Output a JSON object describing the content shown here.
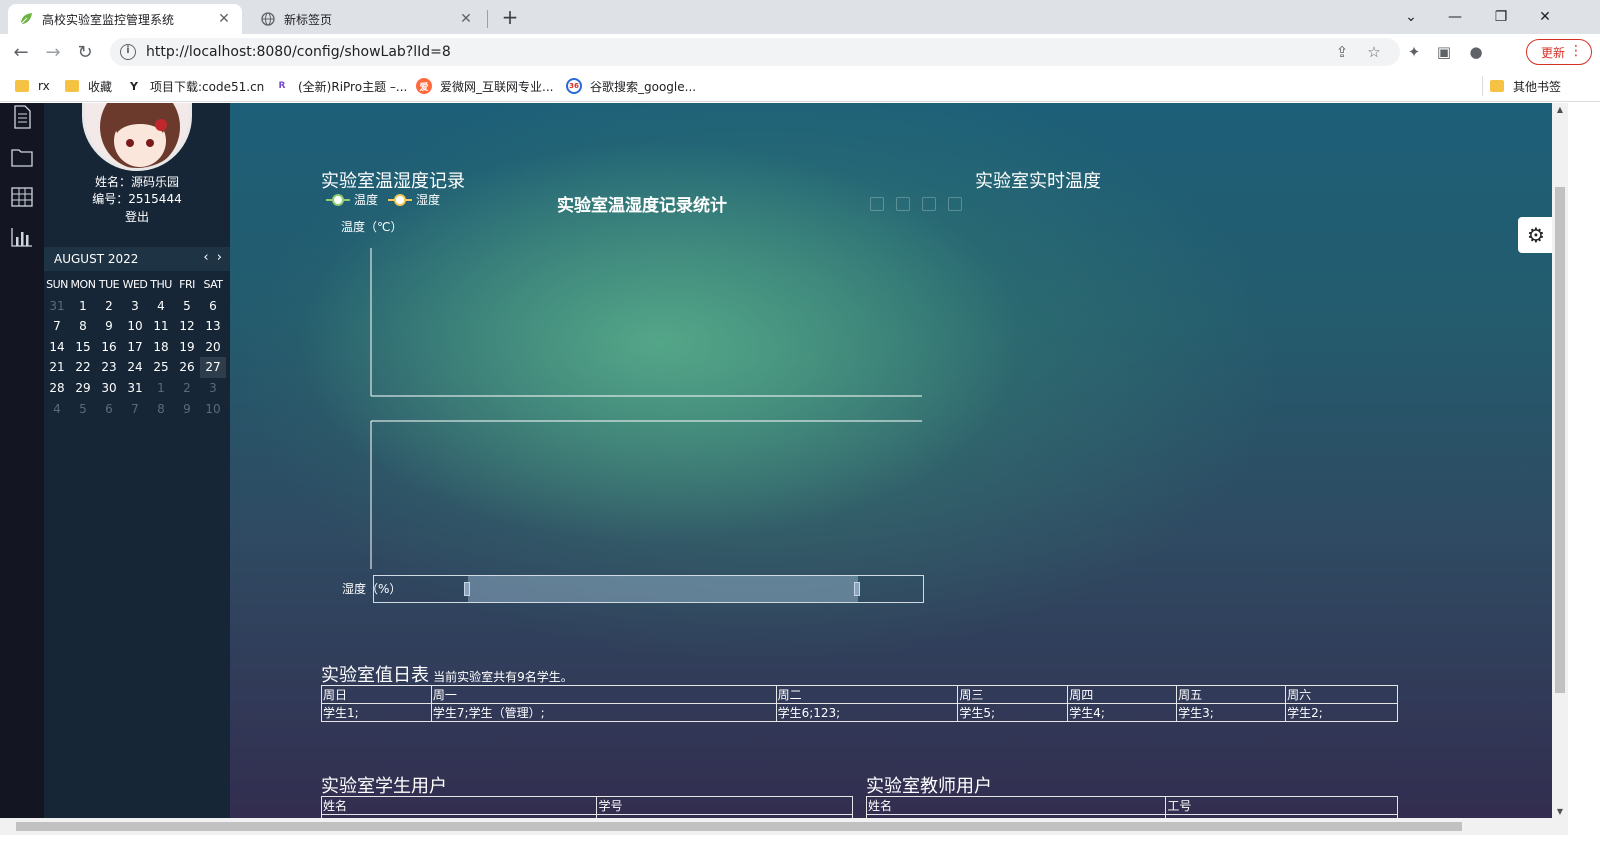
{
  "browser": {
    "tabs": [
      {
        "title": "高校实验室监控管理系统",
        "active": true,
        "icon": "leaf-icon"
      },
      {
        "title": "新标签页",
        "active": false,
        "icon": "globe-icon"
      }
    ],
    "url": "http://localhost:8080/config/showLab?lId=8",
    "update_label": "更新",
    "bookmarks": [
      "rx",
      "收藏",
      "项目下载:code51.cn",
      "(全新)RiPro主题 –...",
      "爱微网_互联网专业...",
      "谷歌搜索_google..."
    ],
    "other_bookmarks": "其他书签"
  },
  "profile": {
    "name": "姓名：源码乐园",
    "id": "编号：2515444",
    "logout": "登出"
  },
  "calendar": {
    "month": "AUGUST 2022",
    "weekdays": [
      "SUN",
      "MON",
      "TUE",
      "WED",
      "THU",
      "FRI",
      "SAT"
    ],
    "weeks": [
      [
        "31",
        "1",
        "2",
        "3",
        "4",
        "5",
        "6"
      ],
      [
        "7",
        "8",
        "9",
        "10",
        "11",
        "12",
        "13"
      ],
      [
        "14",
        "15",
        "16",
        "17",
        "18",
        "19",
        "20"
      ],
      [
        "21",
        "22",
        "23",
        "24",
        "25",
        "26",
        "27"
      ],
      [
        "28",
        "29",
        "30",
        "31",
        "1",
        "2",
        "3"
      ],
      [
        "4",
        "5",
        "6",
        "7",
        "8",
        "9",
        "10"
      ]
    ],
    "today": "27"
  },
  "records": {
    "section_title": "实验室温湿度记录",
    "chart_title": "实验室温湿度记录统计",
    "legend": [
      {
        "name": "温度",
        "color": "#91cc75"
      },
      {
        "name": "湿度",
        "color": "#fac858"
      }
    ],
    "temp_axis": "温度（℃）",
    "humid_axis": "湿度（%）"
  },
  "realtime": {
    "title": "实验室实时温度"
  },
  "duty": {
    "title": "实验室值日表",
    "note": "当前实验室共有9名学生。",
    "headers": [
      "周日",
      "周一",
      "周二",
      "周三",
      "周四",
      "周五",
      "周六"
    ],
    "cells": [
      "学生1;",
      "学生7;学生（管理）;",
      "学生6;123;",
      "学生5;",
      "学生4;",
      "学生3;",
      "学生2;"
    ]
  },
  "students": {
    "title": "实验室学生用户",
    "headers": [
      "姓名",
      "学号"
    ]
  },
  "teachers": {
    "title": "实验室教师用户",
    "headers": [
      "姓名",
      "工号"
    ]
  },
  "chart_data": {
    "type": "line",
    "title": "实验室温湿度记录统计",
    "series": [
      {
        "name": "温度",
        "values": []
      },
      {
        "name": "湿度",
        "values": []
      }
    ],
    "ylabel": "温度（℃）",
    "ylabel2": "湿度（%）",
    "legend": "top-left"
  }
}
